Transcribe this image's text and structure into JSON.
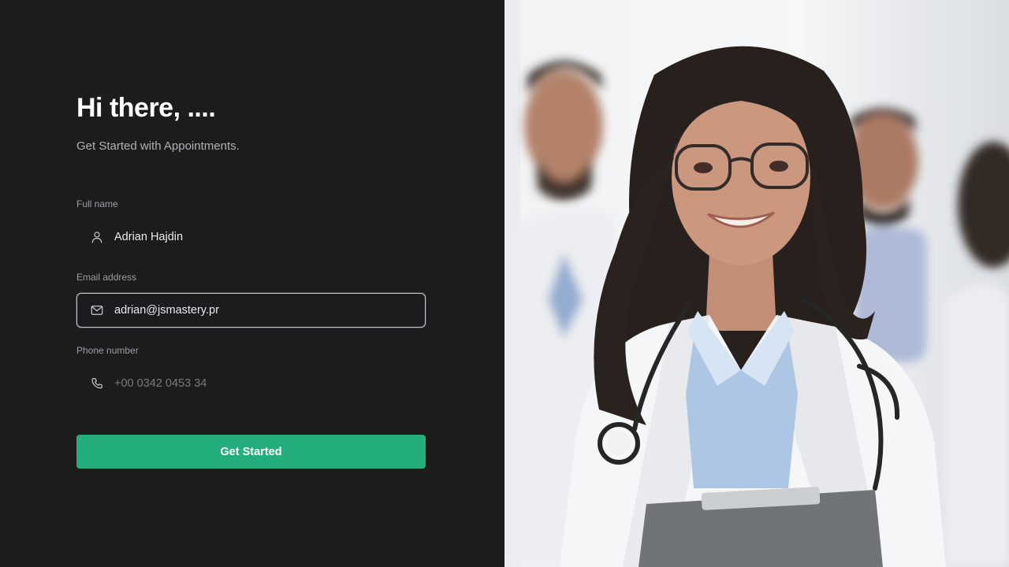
{
  "greeting": {
    "title": "Hi there, ....",
    "subtitle": "Get Started with Appointments."
  },
  "form": {
    "fullname": {
      "label": "Full name",
      "value": "Adrian Hajdin",
      "icon": "user-icon"
    },
    "email": {
      "label": "Email address",
      "value": "adrian@jsmastery.pr",
      "icon": "mail-icon"
    },
    "phone": {
      "label": "Phone number",
      "placeholder": "+00 0342 0453 34",
      "icon": "phone-icon"
    },
    "submit_label": "Get Started"
  },
  "colors": {
    "accent": "#24ae7c",
    "background": "#1c1c1d"
  }
}
